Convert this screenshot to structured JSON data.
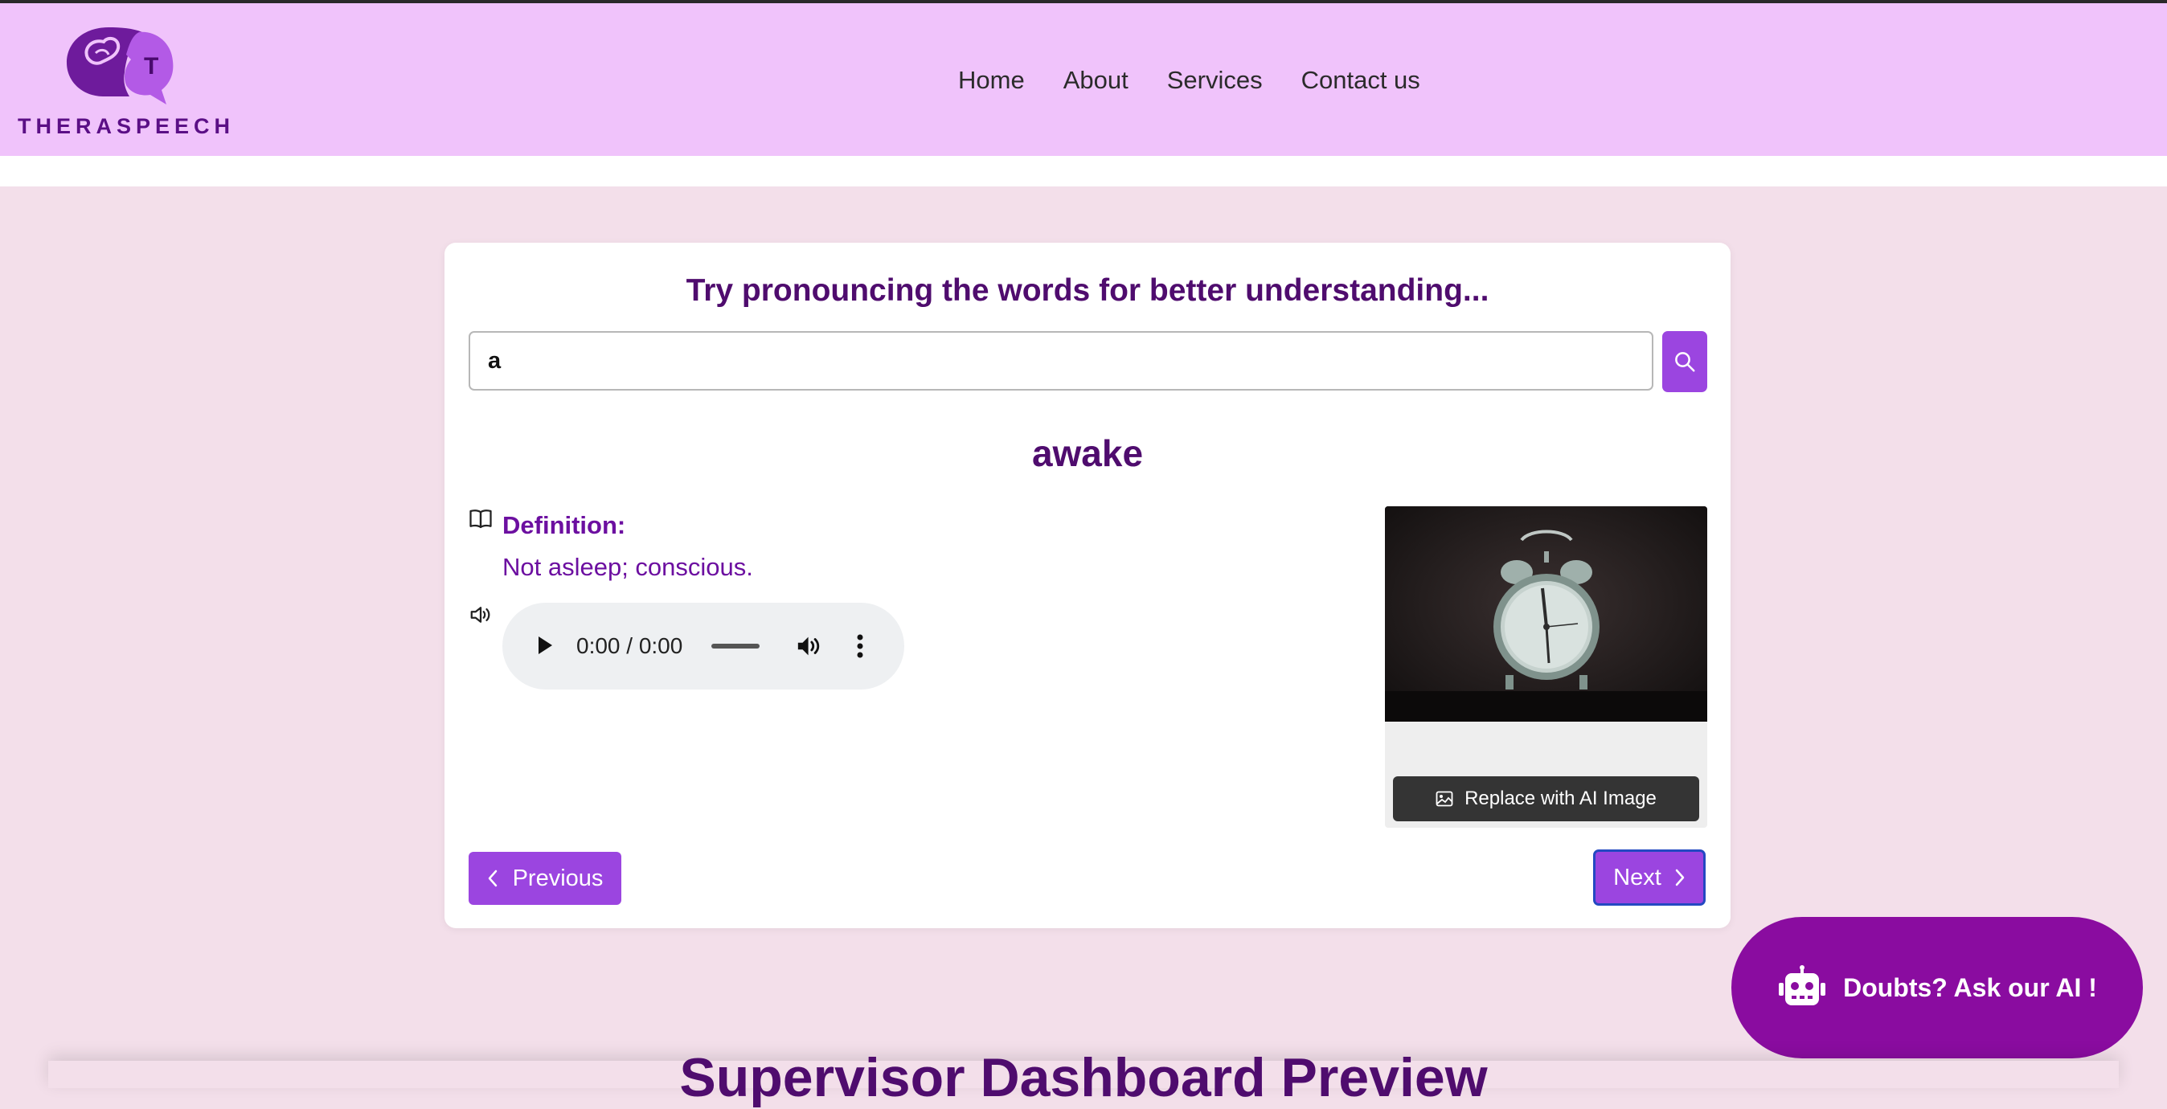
{
  "header": {
    "logo_text": "THERASPEECH",
    "logo_letter": "T",
    "nav": [
      {
        "label": "Home"
      },
      {
        "label": "About"
      },
      {
        "label": "Services"
      },
      {
        "label": "Contact us"
      }
    ]
  },
  "practice": {
    "title": "Try pronouncing the words for better understanding...",
    "search": {
      "value": "a"
    },
    "word": "awake",
    "definition_label": "Definition:",
    "definition": "Not asleep; conscious.",
    "audio": {
      "time": "0:00 / 0:00"
    },
    "replace_image_label": "Replace with AI Image",
    "previous_label": "Previous",
    "next_label": "Next"
  },
  "chat": {
    "label": "Doubts? Ask our AI !"
  },
  "section_title": "Supervisor Dashboard Preview",
  "colors": {
    "header_bg": "#f0c3fb",
    "page_bg": "#f3dfea",
    "accent": "#9b45e0",
    "title_purple": "#4f0c6e",
    "chat_bg": "#8a0ca0"
  },
  "icons": [
    "logo-icon",
    "search-icon",
    "book-icon",
    "speaker-icon",
    "play-icon",
    "volume-icon",
    "more-vertical-icon",
    "image-icon",
    "chevron-left-icon",
    "chevron-right-icon",
    "robot-icon"
  ]
}
